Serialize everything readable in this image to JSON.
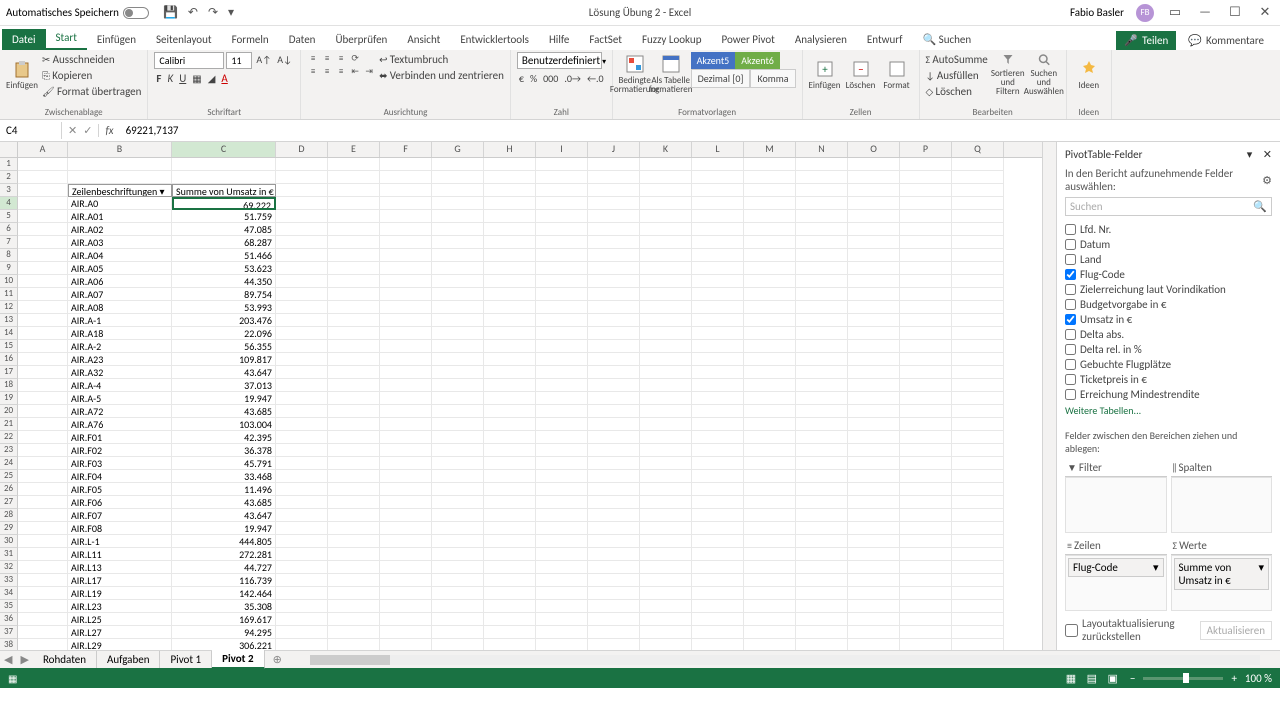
{
  "titlebar": {
    "autosave": "Automatisches Speichern",
    "title": "Lösung Übung 2 - Excel",
    "user": "Fabio Basler",
    "avatar": "FB"
  },
  "tabs": {
    "file": "Datei",
    "list": [
      "Start",
      "Einfügen",
      "Seitenlayout",
      "Formeln",
      "Daten",
      "Überprüfen",
      "Ansicht",
      "Entwicklertools",
      "Hilfe",
      "FactSet",
      "Fuzzy Lookup",
      "Power Pivot",
      "Analysieren",
      "Entwurf"
    ],
    "search_icon": "Suchen",
    "share": "Teilen",
    "comments": "Kommentare"
  },
  "ribbon": {
    "clipboard": {
      "paste": "Einfügen",
      "cut": "Ausschneiden",
      "copy": "Kopieren",
      "format": "Format übertragen",
      "label": "Zwischenablage"
    },
    "font": {
      "name": "Calibri",
      "size": "11",
      "label": "Schriftart"
    },
    "align": {
      "wrap": "Textumbruch",
      "merge": "Verbinden und zentrieren",
      "label": "Ausrichtung"
    },
    "number": {
      "format": "Benutzerdefiniert",
      "label": "Zahl"
    },
    "styles": {
      "cond": "Bedingte Formatierung",
      "table": "Als Tabelle formatieren",
      "a5": "Akzent5",
      "a6": "Akzent6",
      "dec": "Dezimal [0]",
      "komma": "Komma",
      "label": "Formatvorlagen"
    },
    "cells": {
      "insert": "Einfügen",
      "delete": "Löschen",
      "format": "Format",
      "label": "Zellen"
    },
    "editing": {
      "sum": "AutoSumme",
      "fill": "Ausfüllen",
      "clear": "Löschen",
      "sort": "Sortieren und Filtern",
      "find": "Suchen und Auswählen",
      "label": "Bearbeiten"
    },
    "ideas": {
      "btn": "Ideen",
      "label": "Ideen"
    }
  },
  "namebox": "C4",
  "formula": "69221,7137",
  "columns": [
    "A",
    "B",
    "C",
    "D",
    "E",
    "F",
    "G",
    "H",
    "I",
    "J",
    "K",
    "L",
    "M",
    "N",
    "O",
    "P",
    "Q"
  ],
  "pivot": {
    "header_row": "Zeilenbeschriftungen",
    "header_val": "Summe von Umsatz in €",
    "data": [
      [
        "AIR.A0",
        "69.222"
      ],
      [
        "AIR.A01",
        "51.759"
      ],
      [
        "AIR.A02",
        "47.085"
      ],
      [
        "AIR.A03",
        "68.287"
      ],
      [
        "AIR.A04",
        "51.466"
      ],
      [
        "AIR.A05",
        "53.623"
      ],
      [
        "AIR.A06",
        "44.350"
      ],
      [
        "AIR.A07",
        "89.754"
      ],
      [
        "AIR.A08",
        "53.993"
      ],
      [
        "AIR.A-1",
        "203.476"
      ],
      [
        "AIR.A18",
        "22.096"
      ],
      [
        "AIR.A-2",
        "56.355"
      ],
      [
        "AIR.A23",
        "109.817"
      ],
      [
        "AIR.A32",
        "43.647"
      ],
      [
        "AIR.A-4",
        "37.013"
      ],
      [
        "AIR.A-5",
        "19.947"
      ],
      [
        "AIR.A72",
        "43.685"
      ],
      [
        "AIR.A76",
        "103.004"
      ],
      [
        "AIR.F01",
        "42.395"
      ],
      [
        "AIR.F02",
        "36.378"
      ],
      [
        "AIR.F03",
        "45.791"
      ],
      [
        "AIR.F04",
        "33.468"
      ],
      [
        "AIR.F05",
        "11.496"
      ],
      [
        "AIR.F06",
        "43.685"
      ],
      [
        "AIR.F07",
        "43.647"
      ],
      [
        "AIR.F08",
        "19.947"
      ],
      [
        "AIR.L-1",
        "444.805"
      ],
      [
        "AIR.L11",
        "272.281"
      ],
      [
        "AIR.L13",
        "44.727"
      ],
      [
        "AIR.L17",
        "116.739"
      ],
      [
        "AIR.L19",
        "142.464"
      ],
      [
        "AIR.L23",
        "35.308"
      ],
      [
        "AIR.L25",
        "169.617"
      ],
      [
        "AIR.L27",
        "94.295"
      ],
      [
        "AIR.L29",
        "306.221"
      ]
    ]
  },
  "fieldpane": {
    "title": "PivotTable-Felder",
    "sub": "In den Bericht aufzunehmende Felder auswählen:",
    "search": "Suchen",
    "fields": [
      {
        "name": "Lfd. Nr.",
        "checked": false
      },
      {
        "name": "Datum",
        "checked": false
      },
      {
        "name": "Land",
        "checked": false
      },
      {
        "name": "Flug-Code",
        "checked": true
      },
      {
        "name": "Zielerreichung laut Vorindikation",
        "checked": false
      },
      {
        "name": "Budgetvorgabe in €",
        "checked": false
      },
      {
        "name": "Umsatz in €",
        "checked": true
      },
      {
        "name": "Delta abs.",
        "checked": false
      },
      {
        "name": "Delta rel. in %",
        "checked": false
      },
      {
        "name": "Gebuchte Flugplätze",
        "checked": false
      },
      {
        "name": "Ticketpreis in €",
        "checked": false
      },
      {
        "name": "Erreichung Mindestrendite",
        "checked": false
      }
    ],
    "more": "Weitere Tabellen...",
    "drag": "Felder zwischen den Bereichen ziehen und ablegen:",
    "filter": "Filter",
    "cols": "Spalten",
    "rows": "Zeilen",
    "vals": "Werte",
    "row_chip": "Flug-Code",
    "val_chip": "Summe von Umsatz in € ",
    "defer": "Layoutaktualisierung zurückstellen",
    "update": "Aktualisieren"
  },
  "sheets": {
    "list": [
      "Rohdaten",
      "Aufgaben",
      "Pivot 1",
      "Pivot 2"
    ],
    "active": 3
  },
  "status": {
    "zoom": "100 %"
  }
}
